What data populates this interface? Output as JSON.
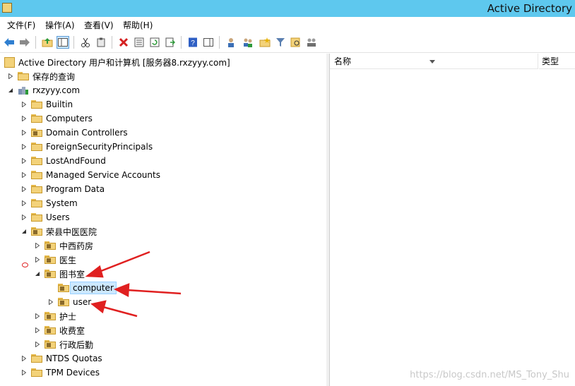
{
  "window": {
    "title": "Active Directory"
  },
  "menu": {
    "items": [
      "文件(F)",
      "操作(A)",
      "查看(V)",
      "帮助(H)"
    ]
  },
  "tree": {
    "root": "Active Directory 用户和计算机 [服务器8.rxzyyy.com]",
    "saved_queries": "保存的查询",
    "domain": "rxzyyy.com",
    "children": [
      "Builtin",
      "Computers",
      "Domain Controllers",
      "ForeignSecurityPrincipals",
      "LostAndFound",
      "Managed Service Accounts",
      "Program Data",
      "System",
      "Users"
    ],
    "ou_main": "荣县中医医院",
    "ou_children": [
      "中西药房",
      "医生"
    ],
    "library": "图书室",
    "library_children": [
      "computer",
      "user"
    ],
    "ou_children_after": [
      "护士",
      "收费室",
      "行政后勤"
    ],
    "tail": [
      "NTDS Quotas",
      "TPM Devices"
    ]
  },
  "list": {
    "columns": [
      "名称",
      "类型"
    ]
  },
  "watermark": "https://blog.csdn.net/MS_Tony_Shu",
  "colors": {
    "title_bar": "#5ec8ee",
    "selection": "#cce8ff",
    "arrow": "#e02020",
    "folder": "#f3d27a"
  }
}
